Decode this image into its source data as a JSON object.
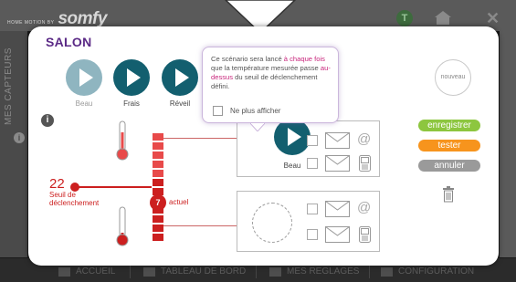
{
  "background": {
    "brand_tagline": "HOME MOTION BY",
    "brand_logo": "somfy",
    "user_badge": "T",
    "side_label": "MES CAPTEURS",
    "footer_nav": [
      {
        "label": "ACCUEIL",
        "icon": "home-icon"
      },
      {
        "label": "TABLEAU DE BORD",
        "icon": "dashboard-icon"
      },
      {
        "label": "MES REGLAGES",
        "icon": "user-icon"
      },
      {
        "label": "CONFIGURATION",
        "icon": "gear-icon"
      }
    ]
  },
  "modal": {
    "title": "SALON",
    "scenarios": [
      {
        "label": "Beau",
        "faded": true
      },
      {
        "label": "Frais",
        "faded": false
      },
      {
        "label": "Réveil",
        "faded": false
      }
    ],
    "nouveau": "nouveau",
    "threshold": {
      "value": "22",
      "label_line1": "Seuil de",
      "label_line2": "déclenchement"
    },
    "current": {
      "value": "7",
      "label": "actuel"
    },
    "card_top": {
      "scenario_label": "Beau"
    },
    "actions": {
      "save": "enregistrer",
      "test": "tester",
      "cancel": "annuler"
    }
  },
  "tooltip": {
    "text_1": "Ce scénario sera lancé ",
    "text_em1": "à chaque fois",
    "text_2": " que la température mesurée passe ",
    "text_em2": "au-dessus",
    "text_3": " du seuil de déclenchement défini.",
    "dont_show": "Ne plus afficher"
  },
  "colors": {
    "title": "#5b2a86",
    "scenario_blue": "#135f6f",
    "threshold_red": "#cc1f1f",
    "save_green": "#8dc63f",
    "test_orange": "#f7941d",
    "cancel_grey": "#9a9a9a",
    "tooltip_emphasis": "#c8267c"
  }
}
